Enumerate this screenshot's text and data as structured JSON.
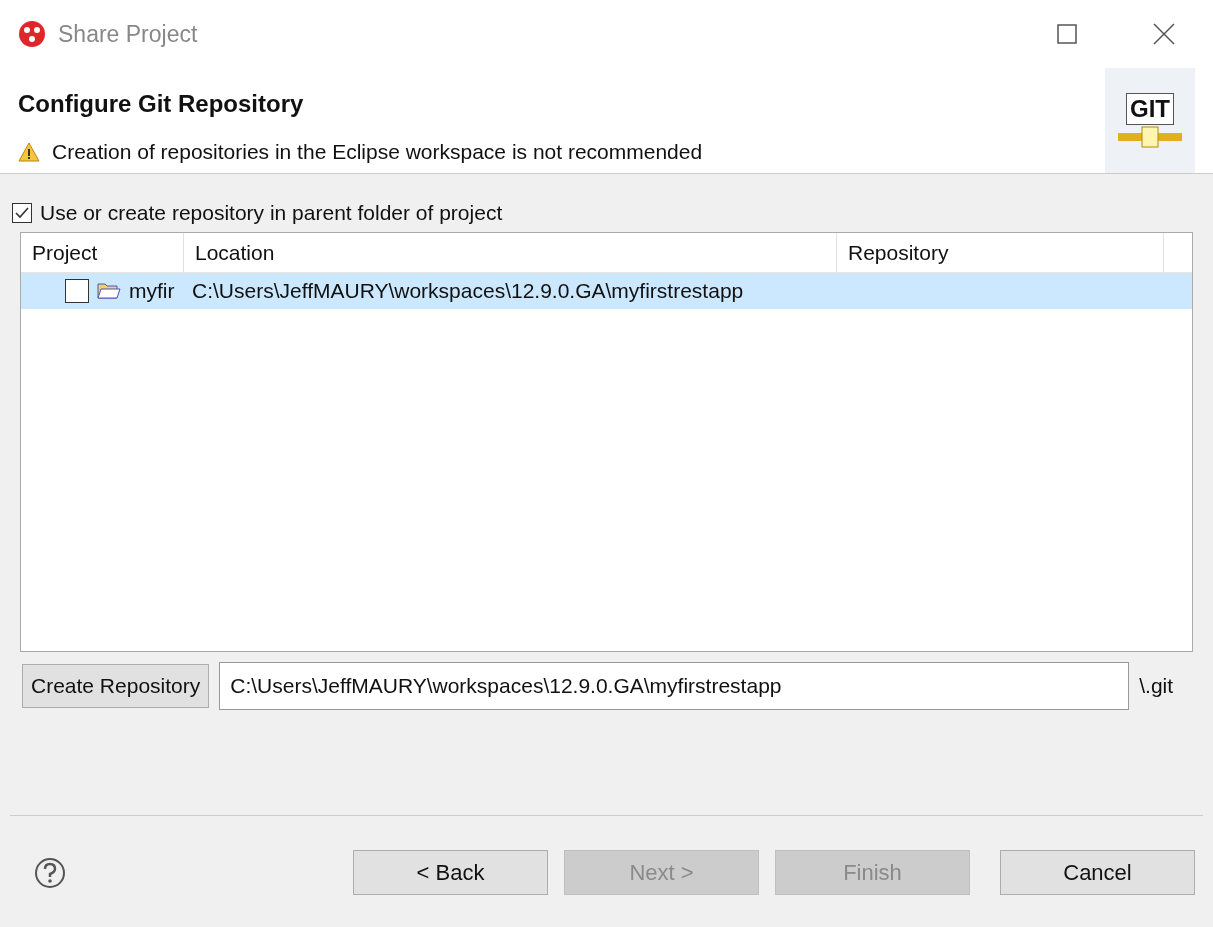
{
  "window": {
    "title": "Share Project"
  },
  "banner": {
    "title": "Configure Git Repository",
    "message": "Creation of repositories in the Eclipse workspace is not recommended",
    "logo_text": "GIT"
  },
  "parent_folder_option": {
    "label": "Use or create repository in parent folder of project",
    "checked": true
  },
  "table": {
    "columns": [
      "Project",
      "Location",
      "Repository"
    ],
    "rows": [
      {
        "project": "myfir",
        "location": "C:\\Users\\JeffMAURY\\workspaces\\12.9.0.GA\\myfirstrestapp",
        "repository": "",
        "checked": false,
        "selected": true
      }
    ]
  },
  "create_repository": {
    "button": "Create Repository",
    "path": "C:\\Users\\JeffMAURY\\workspaces\\12.9.0.GA\\myfirstrestapp",
    "suffix": "\\.git"
  },
  "buttons": [
    {
      "label": "< Back",
      "disabled": false
    },
    {
      "label": "Next >",
      "disabled": true
    },
    {
      "label": "Finish",
      "disabled": true
    },
    {
      "label": "Cancel",
      "disabled": false
    }
  ]
}
